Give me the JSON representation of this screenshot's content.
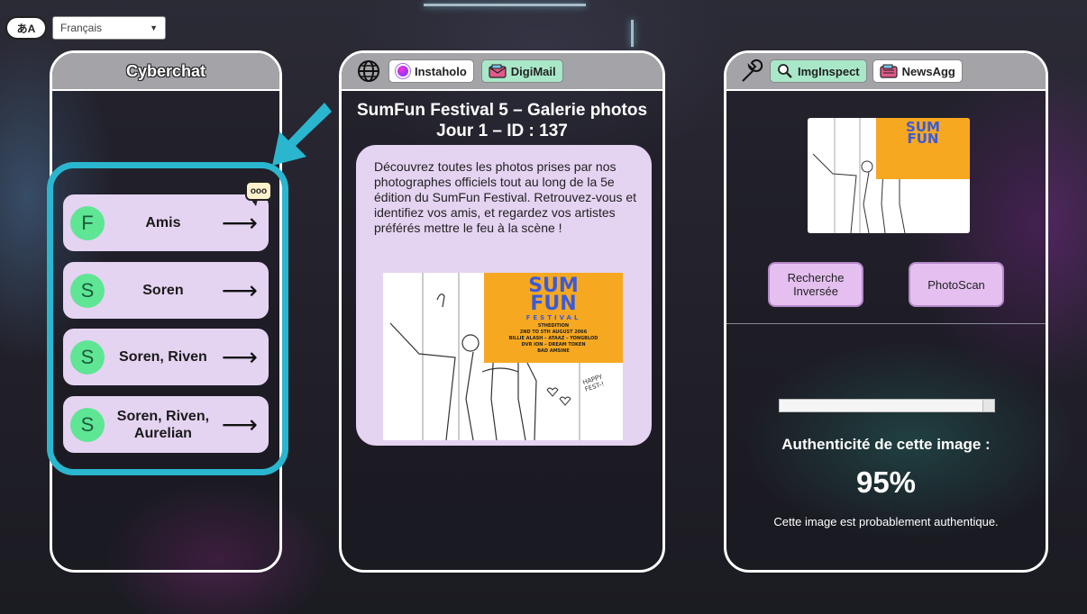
{
  "language": {
    "icon_text": "あA",
    "selected": "Français"
  },
  "cyberchat": {
    "title": "Cyberchat",
    "notification_text": "ooo",
    "conversations": [
      {
        "initial": "F",
        "name": "Amis"
      },
      {
        "initial": "S",
        "name": "Soren"
      },
      {
        "initial": "S",
        "name": "Soren, Riven"
      },
      {
        "initial": "S",
        "name": "Soren, Riven, Aurelian"
      }
    ]
  },
  "browser": {
    "tabs": [
      {
        "label": "Instaholo",
        "icon": "instaholo-icon"
      },
      {
        "label": "DigiMail",
        "icon": "digimail-icon"
      }
    ],
    "page_title": "SumFun Festival 5 – Galerie photos Jour 1 – ID : 137",
    "post_text": "Découvrez toutes les photos prises par nos photographes officiels tout au long de la 5e édition du SumFun Festival. Retrouvez-vous et identifiez vos amis, et regardez vos artistes préférés mettre le feu à la scène !",
    "poster": {
      "title_line1": "SUM",
      "title_line2": "FUN",
      "subtitle": "FESTIVAL",
      "edition": "5THEDITION",
      "dates": "2ND TO 5TH AUGUST 2066",
      "lineup1": "BILLIE ALASH – ATAAZ – YONGBLOD",
      "lineup2": "DVR ION – DREAM TOKEN",
      "lineup3": "BAD AMSINE",
      "sign": "HAPPY FEST-!"
    }
  },
  "inspector": {
    "tabs": [
      {
        "label": "ImgInspect",
        "icon": "magnifier-icon"
      },
      {
        "label": "NewsAgg",
        "icon": "newsagg-icon"
      }
    ],
    "reverse_search_label": "Recherche Inversée",
    "photoscan_label": "PhotoScan",
    "progress": 0.95,
    "authenticity_label": "Authenticité de cette image :",
    "authenticity_value": "95%",
    "authenticity_desc": "Cette image est probablement authentique."
  },
  "colors": {
    "accent_cyan": "#2ab6cf",
    "card_lilac": "#e5d3f2",
    "avatar_green": "#5ee695",
    "active_tab_green": "#a8e8c9",
    "button_pink": "#e5bff0",
    "poster_orange": "#f7a821",
    "poster_blue": "#3b5bd9"
  }
}
